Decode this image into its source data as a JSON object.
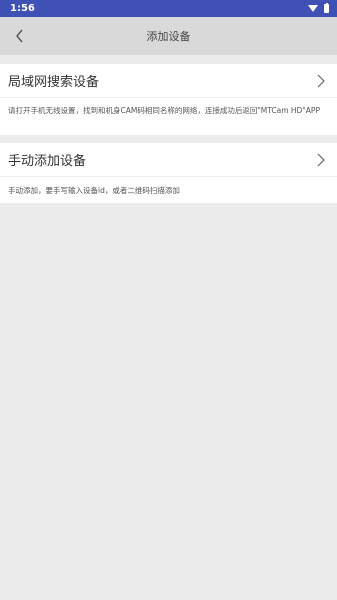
{
  "status_bar": {
    "time": "1:56"
  },
  "app_bar": {
    "title": "添加设备"
  },
  "options": [
    {
      "label": "局域网搜索设备",
      "description": "请打开手机无线设置，找到和机身CAM码相同名称的网络，连接成功后返回\"MTCam HD\"APP"
    },
    {
      "label": "手动添加设备",
      "description": "手动添加，要手写输入设备id，或者二维码扫描添加"
    }
  ],
  "colors": {
    "status_bar": "#3f51b5",
    "app_bar": "#d9d9d9",
    "background": "#ececec"
  }
}
